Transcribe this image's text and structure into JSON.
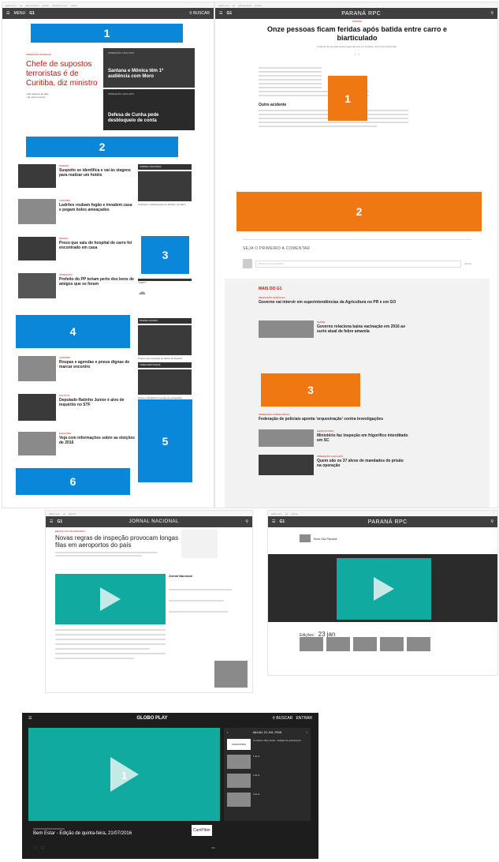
{
  "p1": {
    "topbar_links": [
      "globo.com",
      "g1",
      "globoesporte",
      "gshow",
      "famosos & etc",
      "vídeos"
    ],
    "menu_label": "MENU",
    "logo": "G1",
    "search_label": "BUSCAR",
    "ad1": "1",
    "ad2": "2",
    "ad3": "3",
    "ad4": "4",
    "ad5": "5",
    "ad6": "6",
    "lead": {
      "kicker": "OPERAÇÃO HASHTAG",
      "title": "Chefe de supostos terroristas é de Curitiba, diz ministro",
      "bullets": [
        "Ele aparece ao lado",
        "de outros presos"
      ]
    },
    "feature1": {
      "kicker": "OPERAÇÃO LAVA JATO",
      "title": "Santana e Mônica têm 1ª audiência com Moro"
    },
    "feature2": {
      "kicker": "OPERAÇÃO LAVA JATO",
      "title": "Defesa de Cunha pede desbloqueio de conta"
    },
    "news": [
      {
        "kicker": "PARANÁ",
        "title": "Suspeito se identifica e vai às viagens para realizar um hotéis"
      },
      {
        "kicker": "CURITIBA",
        "title": "Ladrões roubam fogão e invadem casa e pegam bolos ameaçados"
      },
      {
        "kicker": "PRISÃO",
        "title": "Preso que saiu do hospital de carro foi encontrado em casa"
      },
      {
        "kicker": "OPERAÇÃO",
        "title": "Prefeito do PP teriam perto dos bens de amigos que se foram"
      },
      {
        "kicker": "CURITIBA",
        "title": "Roupas e agendas e pneus dignas de marcar encontro"
      },
      {
        "kicker": "POLÍTICA",
        "title": "Deputado Ratinho Junior é alvo de inquérito no STF"
      },
      {
        "kicker": "ELEIÇÕES",
        "title": "Veja com informações sobre as eleições de 2016"
      }
    ],
    "side": [
      {
        "kicker": "JORNAL NACIONAL",
        "title": "Crianças e adolescentes se dividem no bairro"
      },
      {
        "kicker": "TEMPO",
        "title": ""
      },
      {
        "kicker": "PAGINA LIGADA",
        "title": "Projeto que investiga os dados do Paraná"
      },
      {
        "kicker": "VIDEO DESTAQUE",
        "title": "Ponte é atingida por equipe de campanha"
      }
    ]
  },
  "p2": {
    "logo": "PARANÁ RPC",
    "kicker": "PARANÁ",
    "title": "Onze pessoas ficam feridas após batida entre carro e biarticulado",
    "subtitle": "Acidente foi na tarde desta segunda-feira em Curitiba. Carro ficou destruído.",
    "ad1": "1",
    "ad2": "2",
    "ad3": "3",
    "subhead": "Outro acidente",
    "comment_title": "SEJA O PRIMEIRO A COMENTAR",
    "comment_placeholder": "Escreva um comentário...",
    "comment_btn": "Enviar",
    "more_title": "MAIS DO G1",
    "items": [
      {
        "kicker": "PRODUÇÃO AGRÍCOLA",
        "title": "Governo vai intervir em superintendências da Agricultura no PR e em GO"
      },
      {
        "kicker": "SAÚDE",
        "title": "Governo relaciona baixa vacinação em 2016 ao surto atual de febre amarela"
      },
      {
        "kicker": "OPERAÇÃO CARNE FRACA",
        "title": "Federação de policiais aponta 'orquestração' contra investigações"
      },
      {
        "kicker": "AGRICULTURA",
        "title": "Ministério faz inspeção em frigorífico interditado em SC"
      },
      {
        "kicker": "OPERAÇÃO LAVA JATO",
        "title": "Quem são os 37 alvos de mandados de prisão na operação"
      }
    ]
  },
  "p3": {
    "logo_left": "G1",
    "logo": "JORNAL NACIONAL",
    "kicker": "EDIÇÃO DO DIA 25/04/2017",
    "title": "Novas regras de inspeção provocam longas filas em aeroportos do país",
    "program": "Jornal Nacional"
  },
  "p4": {
    "logo": "PARANÁ RPC",
    "show": "Bom Dia Paraná",
    "editions_label": "Edições:",
    "editions_date": "23 jan"
  },
  "p5": {
    "logo": "GLOBO PLAY",
    "search": "BUSCAR",
    "enter": "ENTRAR",
    "date": "#ALIAL 21 JUL 2016",
    "label1": "1",
    "title": "Bem Estar - Edição de quinta-feira, 21/07/2016",
    "sponsor": "CamPitter",
    "list": [
      {
        "tag": "ASSISTINDO",
        "title": "Completo: Bem Estar - Edição de quinta-feira"
      },
      {
        "tag": "",
        "title": "1 de 6"
      },
      {
        "tag": "",
        "title": "2 de 6"
      },
      {
        "tag": "",
        "title": "3 de 6"
      }
    ]
  },
  "colors": {
    "blue": "#0a87d9",
    "orange": "#f07812",
    "teal": "#11aaa0",
    "nav": "#3f3f3f"
  }
}
